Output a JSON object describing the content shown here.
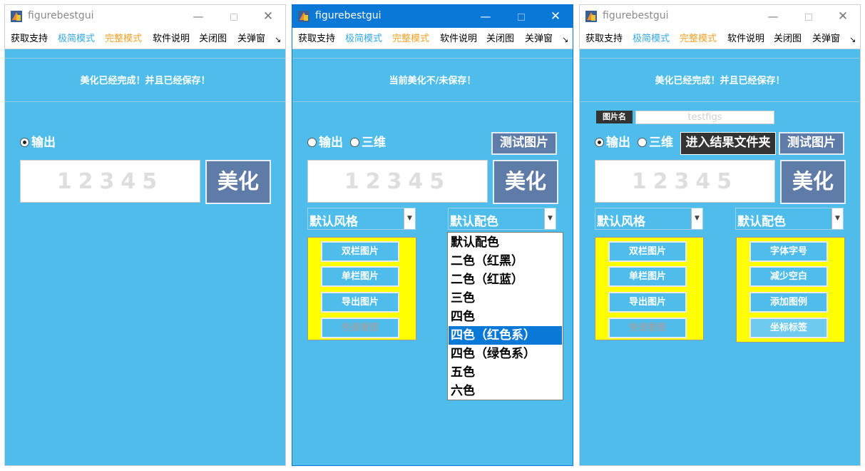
{
  "colors": {
    "content_bg": "#4fbdeb",
    "titlebar_active": "#0a78d7",
    "menu_blue": "#35a9e0",
    "menu_orange": "#f0a22a",
    "button_blue": "#5f7ba8",
    "panel_yellow": "#ffff00",
    "selected_item": "#0a78d7"
  },
  "windows": [
    {
      "title": "figurebestgui",
      "menu": [
        "获取支持",
        "极简模式",
        "完整模式",
        "软件说明",
        "关闭图",
        "关弹窗",
        "↘"
      ],
      "status": "美化已经完成！并且已经保存！",
      "radios": [
        "输出"
      ],
      "input_value": "12345",
      "beautify_label": "美化"
    },
    {
      "title": "figurebestgui",
      "menu": [
        "获取支持",
        "极简模式",
        "完整模式",
        "软件说明",
        "关闭图",
        "关弹窗",
        "↘"
      ],
      "status": "当前美化不/未保存！",
      "radios": [
        "输出",
        "三维"
      ],
      "test_label": "测试图片",
      "input_value": "12345",
      "beautify_label": "美化",
      "style_select": "默认风格",
      "color_select": "默认配色",
      "buttons": [
        "双栏图片",
        "单栏图片",
        "导出图片",
        "快速看图"
      ],
      "dropdown_options": [
        "默认配色",
        "二色（红黑）",
        "二色（红蓝）",
        "三色",
        "四色",
        "四色（红色系）",
        "四色（绿色系）",
        "五色",
        "六色"
      ],
      "dropdown_selected": "四色（红色系）"
    },
    {
      "title": "figurebestgui",
      "menu": [
        "获取支持",
        "极简模式",
        "完整模式",
        "软件说明",
        "关闭图",
        "关弹窗",
        "↘"
      ],
      "status": "美化已经完成！并且已经保存！",
      "name_label": "图片名",
      "name_value": "testfigs",
      "radios": [
        "输出",
        "三维"
      ],
      "folder_label": "进入结果文件夹",
      "test_label": "测试图片",
      "input_value": "12345",
      "beautify_label": "美化",
      "style_select": "默认风格",
      "color_select": "默认配色",
      "buttons_left": [
        "双栏图片",
        "单栏图片",
        "导出图片",
        "快速看图"
      ],
      "buttons_right": [
        "字体字号",
        "减少空白",
        "添加图例",
        "坐标标签"
      ]
    }
  ]
}
